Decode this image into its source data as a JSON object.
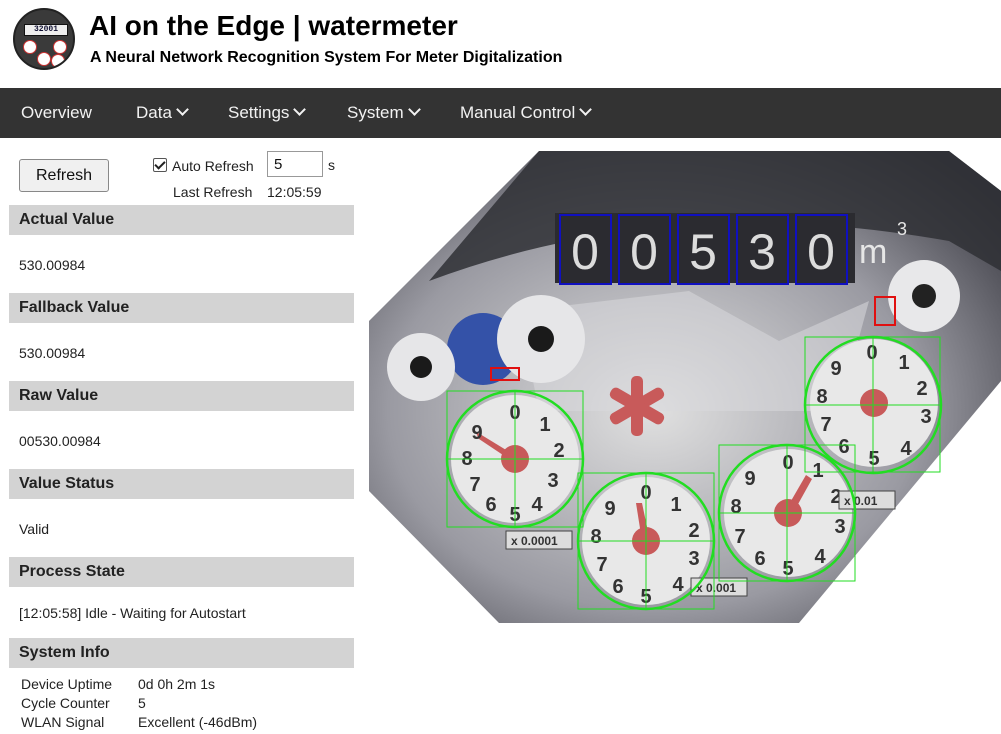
{
  "header": {
    "title": "AI on the Edge | watermeter",
    "subtitle": "A Neural Network Recognition System For Meter Digitalization",
    "logo_text": "32001"
  },
  "nav": {
    "items": [
      {
        "label": "Overview"
      },
      {
        "label": "Data"
      },
      {
        "label": "Settings"
      },
      {
        "label": "System"
      },
      {
        "label": "Manual Control"
      }
    ]
  },
  "controls": {
    "refresh_label": "Refresh",
    "auto_refresh_label": "Auto Refresh",
    "auto_refresh_checked": true,
    "interval_value": "5",
    "interval_unit": "s",
    "last_refresh_label": "Last Refresh",
    "last_refresh_time": "12:05:59"
  },
  "sections": {
    "actual": {
      "title": "Actual Value",
      "value": "530.00984"
    },
    "fallback": {
      "title": "Fallback Value",
      "value": "530.00984"
    },
    "raw": {
      "title": "Raw Value",
      "value": "00530.00984"
    },
    "status": {
      "title": "Value Status",
      "value": "Valid"
    },
    "process": {
      "title": "Process State",
      "value": "[12:05:58] Idle - Waiting for Autostart"
    },
    "sysinfo": {
      "title": "System Info",
      "rows": [
        {
          "key": "Device Uptime",
          "value": "0d 0h 2m 1s"
        },
        {
          "key": "Cycle Counter",
          "value": "5"
        },
        {
          "key": "WLAN Signal",
          "value": "Excellent (-46dBm)"
        }
      ]
    }
  },
  "meter_image": {
    "digits": [
      "0",
      "0",
      "5",
      "3",
      "0"
    ],
    "unit": "m",
    "unit_exp": "3",
    "multiplier_labels": [
      "x 0.0001",
      "x 0.001",
      "x 0.01"
    ],
    "colors": {
      "digit_roi": "#1010c0",
      "analog_roi": "#22dd22",
      "align_marker": "#e01010"
    }
  }
}
